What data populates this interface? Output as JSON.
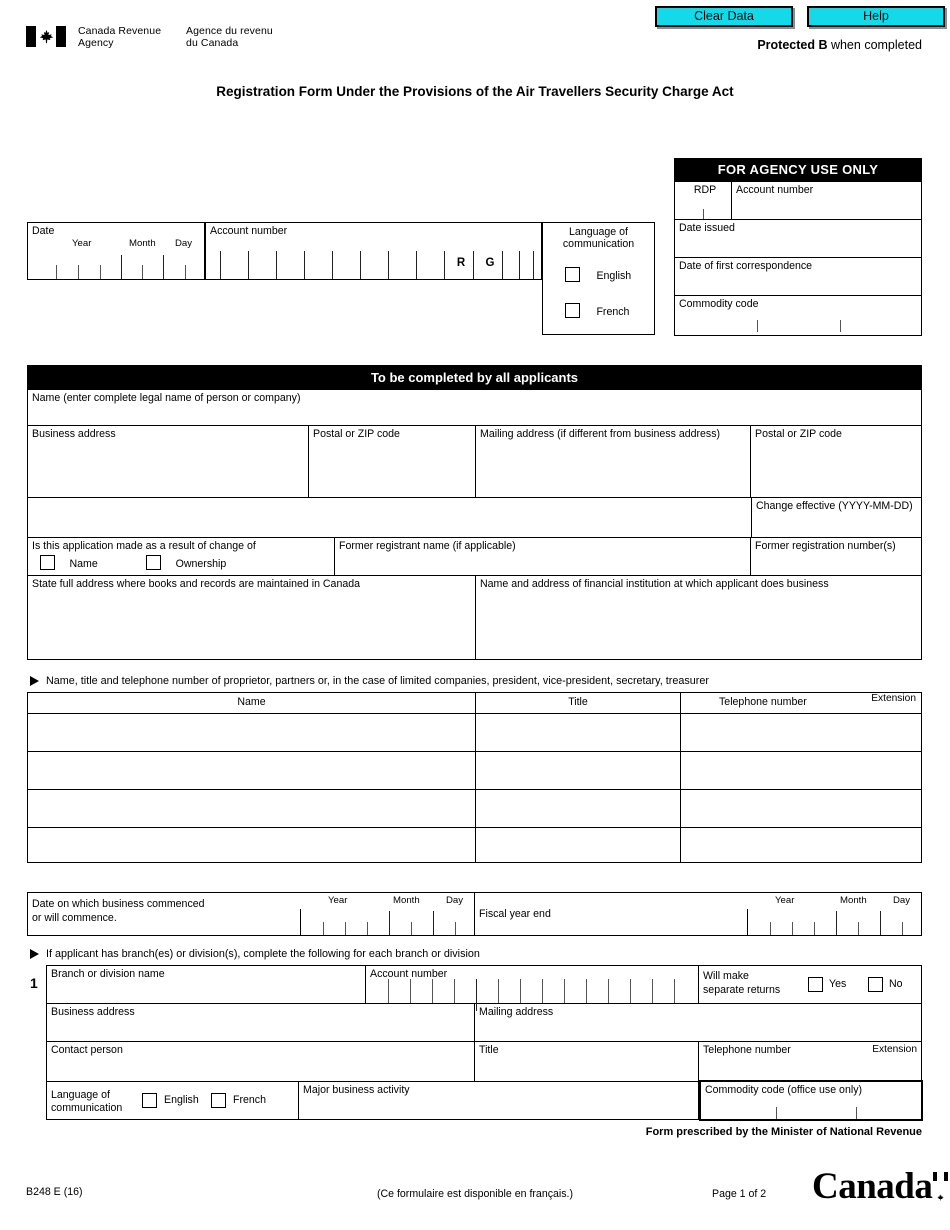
{
  "toolbar": {
    "clear_data_label": "Clear Data",
    "help_label": "Help"
  },
  "header": {
    "agency_en_line1": "Canada Revenue",
    "agency_en_line2": "Agency",
    "agency_fr_line1": "Agence du revenu",
    "agency_fr_line2": "du Canada",
    "protected_bold": "Protected B",
    "protected_rest": " when completed",
    "form_title": "Registration Form Under the Provisions of the Air Travellers Security Charge Act"
  },
  "agency_use": {
    "heading": "FOR AGENCY USE ONLY",
    "rdp_label": "RDP",
    "account_number_label": "Account number",
    "date_issued_label": "Date issued",
    "date_first_correspondence_label": "Date of first correspondence",
    "commodity_code_label": "Commodity code"
  },
  "date_block": {
    "date_label": "Date",
    "year_label": "Year",
    "month_label": "Month",
    "day_label": "Day"
  },
  "account_block": {
    "label": "Account number",
    "program_letter_1": "R",
    "program_letter_2": "G"
  },
  "language_block": {
    "title_line1": "Language of",
    "title_line2": "communication",
    "english_label": "English",
    "french_label": "French"
  },
  "applicants_section": {
    "heading": "To be completed by all applicants",
    "name_label": "Name (enter complete legal name of person or company)",
    "business_address_label": "Business address",
    "postal_zip_label_1": "Postal or ZIP code",
    "mailing_address_label": "Mailing address (if different from business address)",
    "postal_zip_label_2": "Postal or ZIP code",
    "change_effective_label": "Change effective ",
    "change_effective_format": "(YYYY-MM-DD)",
    "change_question": "Is this application made as a result of change of",
    "change_name_label": "Name",
    "change_ownership_label": "Ownership",
    "former_registrant_label": "Former registrant name (if applicable)",
    "former_registration_numbers_label": "Former registration number(s)",
    "books_records_label": "State full address where books and records are maintained in Canada",
    "financial_institution_label": "Name and address of financial institution at which applicant does business"
  },
  "officers_section": {
    "note": "Name, title and telephone number of proprietor, partners or, in the case of limited companies, president, vice-president, secretary, treasurer",
    "columns": [
      "Name",
      "Title",
      "Telephone number",
      "Extension"
    ],
    "rows": [
      {
        "name": "",
        "title": "",
        "telephone": "",
        "extension": ""
      },
      {
        "name": "",
        "title": "",
        "telephone": "",
        "extension": ""
      },
      {
        "name": "",
        "title": "",
        "telephone": "",
        "extension": ""
      },
      {
        "name": "",
        "title": "",
        "telephone": "",
        "extension": ""
      }
    ]
  },
  "commence_section": {
    "commenced_line1": "Date on which business commenced",
    "commenced_line2": "or will commence.",
    "fiscal_year_end_label": "Fiscal year end",
    "year_label": "Year",
    "month_label": "Month",
    "day_label": "Day"
  },
  "branch_section": {
    "note": "If applicant has branch(es) or division(s), complete the following for each branch or division",
    "index": "1",
    "branch_name_label": "Branch or division name",
    "account_number_label": "Account number",
    "separate_returns_line1": "Will make",
    "separate_returns_line2": "separate returns",
    "yes_label": "Yes",
    "no_label": "No",
    "business_address_label": "Business address",
    "mailing_address_label": "Mailing address",
    "contact_person_label": "Contact person",
    "title_label": "Title",
    "telephone_label": "Telephone number",
    "extension_label": "Extension",
    "language_line1": "Language of",
    "language_line2": "communication",
    "english_label": "English",
    "french_label": "French",
    "major_activity_label": "Major business activity",
    "commodity_code_label": "Commodity code (office use only)"
  },
  "footer": {
    "prescribed": "Form prescribed by the Minister of National Revenue",
    "form_code": "B248 E (16)",
    "french_note": "(Ce formulaire est disponible en français.)",
    "page_label": "Page 1 of 2",
    "wordmark": "Canada"
  },
  "colors": {
    "button_cyan": "#14D9E8",
    "section_black": "#000000",
    "page_background": "#FFFFFF"
  }
}
